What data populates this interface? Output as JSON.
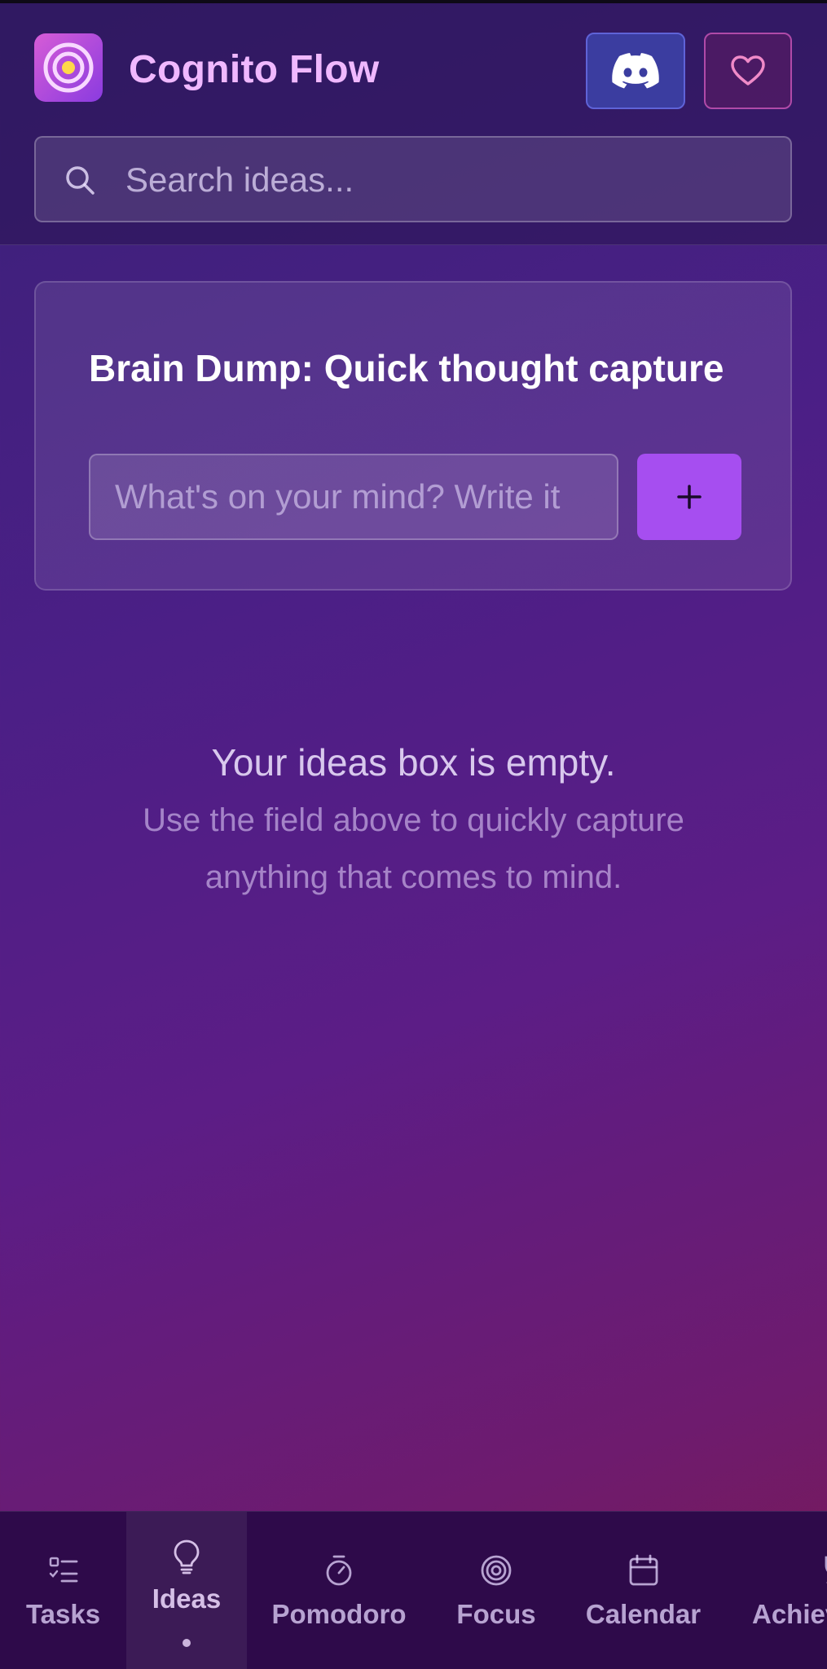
{
  "app": {
    "title": "Cognito Flow"
  },
  "header": {
    "discord_icon": "discord-icon",
    "heart_icon": "heart-icon"
  },
  "search": {
    "placeholder": "Search ideas..."
  },
  "brain_dump": {
    "title": "Brain Dump: Quick thought capture",
    "input_placeholder": "What's on your mind? Write it",
    "add_icon": "plus-icon"
  },
  "empty_state": {
    "title": "Your ideas box is empty.",
    "line1": "Use the field above to quickly capture",
    "line2": "anything that comes to mind."
  },
  "nav": {
    "items": [
      {
        "label": "Tasks",
        "icon": "tasks-icon"
      },
      {
        "label": "Ideas",
        "icon": "lightbulb-icon",
        "active": true
      },
      {
        "label": "Pomodoro",
        "icon": "timer-icon"
      },
      {
        "label": "Focus",
        "icon": "target-icon"
      },
      {
        "label": "Calendar",
        "icon": "calendar-icon"
      },
      {
        "label": "Achievements",
        "icon": "trophy-icon"
      }
    ]
  },
  "colors": {
    "accent": "#a64ef0",
    "title": "#f0b8ff",
    "discord": "#3b3da0",
    "nav_bg": "#2e0a4a"
  }
}
